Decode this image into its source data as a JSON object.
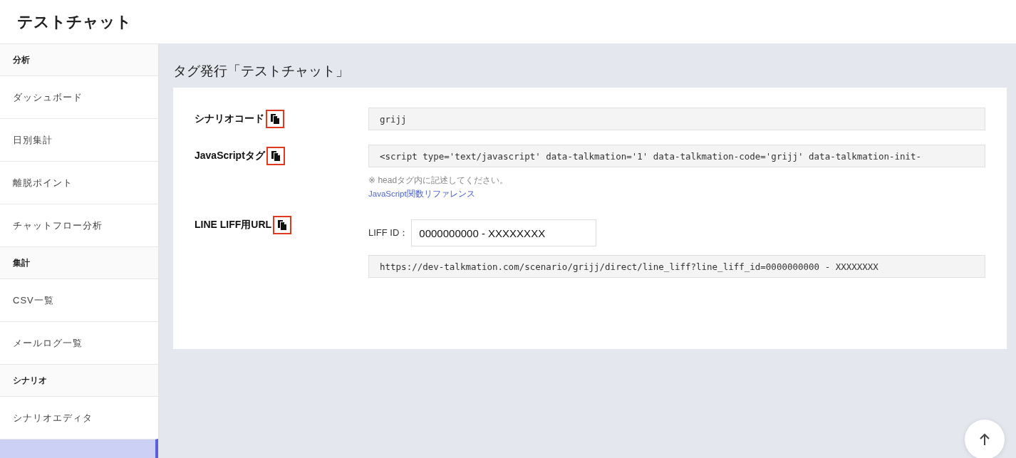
{
  "header": {
    "title": "テストチャット"
  },
  "sidebar": {
    "sections": [
      {
        "heading": "分析",
        "items": [
          {
            "label": "ダッシュボード",
            "selected": false
          },
          {
            "label": "日別集計",
            "selected": false
          },
          {
            "label": "離脱ポイント",
            "selected": false
          },
          {
            "label": "チャットフロー分析",
            "selected": false
          }
        ]
      },
      {
        "heading": "集計",
        "items": [
          {
            "label": "CSV一覧",
            "selected": false
          },
          {
            "label": "メールログ一覧",
            "selected": false
          }
        ]
      },
      {
        "heading": "シナリオ",
        "items": [
          {
            "label": "シナリオエディタ",
            "selected": false
          },
          {
            "selected": true
          }
        ]
      }
    ]
  },
  "page_title": "タグ発行「テストチャット」",
  "rows": [
    {
      "kind": "code",
      "label": "シナリオコード",
      "value": "grijj"
    },
    {
      "kind": "code_note",
      "label": "JavaScriptタグ",
      "value": "<script type='text/javascript' data-talkmation='1' data-talkmation-code='grijj' data-talkmation-init-",
      "note": "※ headタグ内に記述してください。",
      "link": "JavaScript関数リファレンス"
    },
    {
      "kind": "liff",
      "label": "LINE LIFF用URL",
      "input_label": "LIFF ID：",
      "input_value": "0000000000 - XXXXXXXX",
      "value": "https://dev-talkmation.com/scenario/grijj/direct/line_liff?line_liff_id=0000000000 - XXXXXXXX"
    }
  ]
}
